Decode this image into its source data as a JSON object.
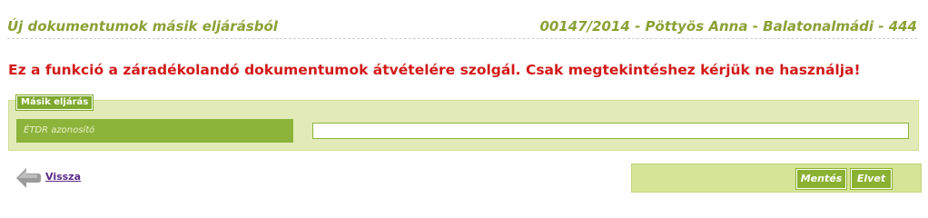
{
  "header": {
    "title": "Új dokumentumok másik eljárásból",
    "case_info": "00147/2014 - Pöttyös Anna - Balatonalmádi - 444"
  },
  "warning": "Ez a funkció a záradékolandó dokumentumok átvételére szolgál. Csak megtekintéshez kérjük ne használja!",
  "form": {
    "legend": "Másik eljárás",
    "field_label": "ÉTDR azonosító",
    "field_value": ""
  },
  "nav": {
    "back_label": "Vissza"
  },
  "actions": {
    "save_label": "Mentés",
    "discard_label": "Elvet"
  },
  "colors": {
    "accent": "#8db33b",
    "header_text": "#8aa136",
    "warning": "#d21a1a",
    "panel_bg": "#e2ebb8"
  }
}
